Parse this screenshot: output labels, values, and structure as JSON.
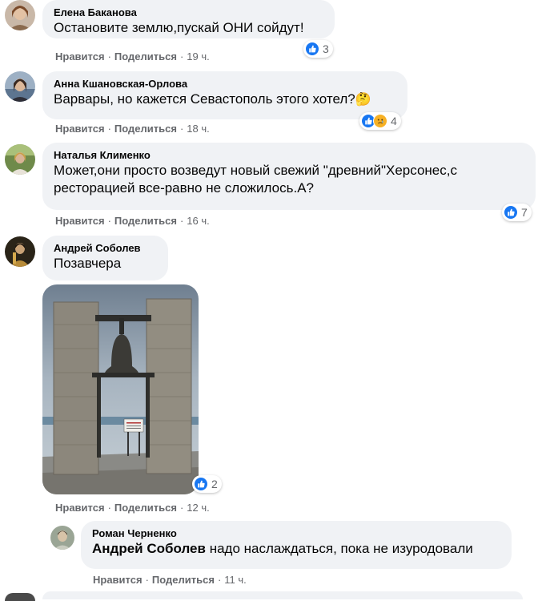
{
  "actions": {
    "like": "Нравится",
    "share": "Поделиться",
    "dot": "·"
  },
  "colors": {
    "bubble": "#f0f2f5",
    "meta": "#65676b",
    "like_blue": "#1877f2"
  },
  "comments": [
    {
      "author": "Елена Баканова",
      "text": "Остановите землю,пускай ОНИ сойдут!",
      "time": "19 ч.",
      "reactions": {
        "icons": [
          "like-icon"
        ],
        "count": "3"
      }
    },
    {
      "author": "Анна Кшановская-Орлова",
      "text": "Варвары, но кажется Севастополь этого хотел?",
      "emoji": "🤔",
      "time": "18 ч.",
      "reactions": {
        "icons": [
          "like-icon",
          "sad-icon"
        ],
        "count": "4"
      }
    },
    {
      "author": "Наталья Клименко",
      "text_line1": "Может,они просто возведут новый свежий \"древний\"Херсонес,с",
      "text_line2": "ресторацией все-равно не сложилось.А?",
      "time": "16 ч.",
      "reactions": {
        "icons": [
          "like-icon"
        ],
        "count": "7"
      }
    },
    {
      "author": "Андрей Соболев",
      "text": "Позавчера",
      "time": "12 ч.",
      "photo": "bell-tower-photo",
      "reactions": {
        "icons": [
          "like-icon"
        ],
        "count": "2"
      }
    },
    {
      "author": "Роман Черненко",
      "mention": "Андрей Соболев",
      "text": "надо наслаждаться, пока не изуродовали",
      "time": "11 ч."
    }
  ]
}
